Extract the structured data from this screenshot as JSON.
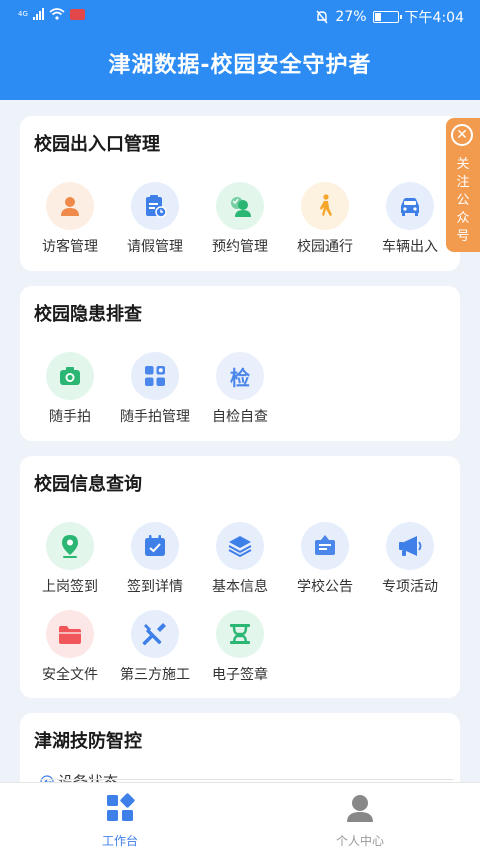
{
  "status_bar": {
    "network": "4G",
    "battery": "27%",
    "time": "下午4:04",
    "battery_level": 0.27
  },
  "header": {
    "title": "津湖数据-校园安全守护者"
  },
  "side_tab": {
    "label": "关注公众号"
  },
  "sections": [
    {
      "title": "校园出入口管理",
      "items": [
        {
          "label": "访客管理",
          "icon": "user-icon",
          "color": "#f08a4b",
          "bg": "#fdeee3"
        },
        {
          "label": "请假管理",
          "icon": "clipboard-clock-icon",
          "color": "#3f7fe8",
          "bg": "#e6eefc"
        },
        {
          "label": "预约管理",
          "icon": "user-check-icon",
          "color": "#2bb673",
          "bg": "#e3f6ec"
        },
        {
          "label": "校园通行",
          "icon": "walking-person-icon",
          "color": "#f4a52a",
          "bg": "#fdf1e0"
        },
        {
          "label": "车辆出入",
          "icon": "car-icon",
          "color": "#3f7fe8",
          "bg": "#e6eefc"
        }
      ]
    },
    {
      "title": "校园隐患排查",
      "items": [
        {
          "label": "随手拍",
          "icon": "camera-icon",
          "color": "#2bb673",
          "bg": "#e3f6ec"
        },
        {
          "label": "随手拍管理",
          "icon": "grid-camera-icon",
          "color": "#4b86ea",
          "bg": "#e6eefc"
        },
        {
          "label": "自检自查",
          "icon": "check-text-icon",
          "glyph": "检",
          "color": "#4b86ea",
          "bg": "#e9f0fc"
        }
      ]
    },
    {
      "title": "校园信息查询",
      "items": [
        {
          "label": "上岗签到",
          "icon": "location-pin-icon",
          "color": "#2bb673",
          "bg": "#e3f6ec"
        },
        {
          "label": "签到详情",
          "icon": "calendar-check-icon",
          "color": "#3f7fe8",
          "bg": "#e6eefc"
        },
        {
          "label": "基本信息",
          "icon": "layers-icon",
          "color": "#3f7fe8",
          "bg": "#e6eefc"
        },
        {
          "label": "学校公告",
          "icon": "notice-board-icon",
          "color": "#4b86ea",
          "bg": "#e6eefc"
        },
        {
          "label": "专项活动",
          "icon": "megaphone-icon",
          "color": "#3f7fe8",
          "bg": "#e6eefc"
        },
        {
          "label": "安全文件",
          "icon": "folder-icon",
          "color": "#f0565a",
          "bg": "#fde6e6"
        },
        {
          "label": "第三方施工",
          "icon": "tools-icon",
          "color": "#3f7fe8",
          "bg": "#e6eefc"
        },
        {
          "label": "电子签章",
          "icon": "seal-icon",
          "color": "#2bb673",
          "bg": "#e3f6ec"
        }
      ]
    },
    {
      "title": "津湖技防智控",
      "device_status": "设备状态"
    }
  ],
  "tabbar": [
    {
      "label": "工作台",
      "icon": "workbench-icon",
      "active": true
    },
    {
      "label": "个人中心",
      "icon": "person-icon",
      "active": false
    }
  ],
  "colors": {
    "primary": "#2c8cf4",
    "accent_orange": "#f29a4e"
  }
}
